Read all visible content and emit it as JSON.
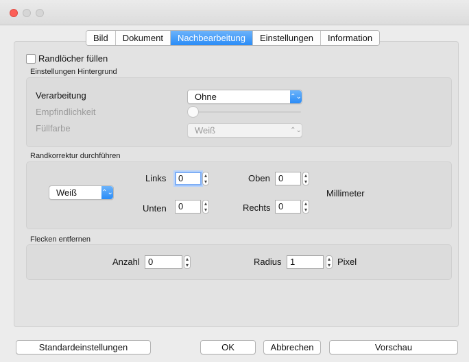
{
  "tabs": [
    "Bild",
    "Dokument",
    "Nachbearbeitung",
    "Einstellungen",
    "Information"
  ],
  "active_tab": "Nachbearbeitung",
  "fill_holes": {
    "label": "Randlöcher füllen",
    "checked": false
  },
  "background": {
    "title": "Einstellungen Hintergrund",
    "processing_label": "Verarbeitung",
    "processing_value": "Ohne",
    "sensitivity_label": "Empfindlichkeit",
    "sensitivity_level": 0,
    "fill_color_label": "Füllfarbe",
    "fill_color_value": "Weiß"
  },
  "edge": {
    "title": "Randkorrektur durchführen",
    "color_value": "Weiß",
    "left_label": "Links",
    "left_value": "0",
    "top_label": "Oben",
    "top_value": "0",
    "bottom_label": "Unten",
    "bottom_value": "0",
    "right_label": "Rechts",
    "right_value": "0",
    "unit": "Millimeter"
  },
  "spots": {
    "title": "Flecken entfernen",
    "count_label": "Anzahl",
    "count_value": "0",
    "radius_label": "Radius",
    "radius_value": "1",
    "unit": "Pixel"
  },
  "buttons": {
    "defaults": "Standardeinstellungen",
    "ok": "OK",
    "cancel": "Abbrechen",
    "preview": "Vorschau"
  },
  "colors": {
    "accent": "#2a8cf7",
    "close": "#fc5f57"
  },
  "icons": {
    "stepper": "up-down-stepper-icon",
    "select": "up-down-chevron-icon"
  }
}
